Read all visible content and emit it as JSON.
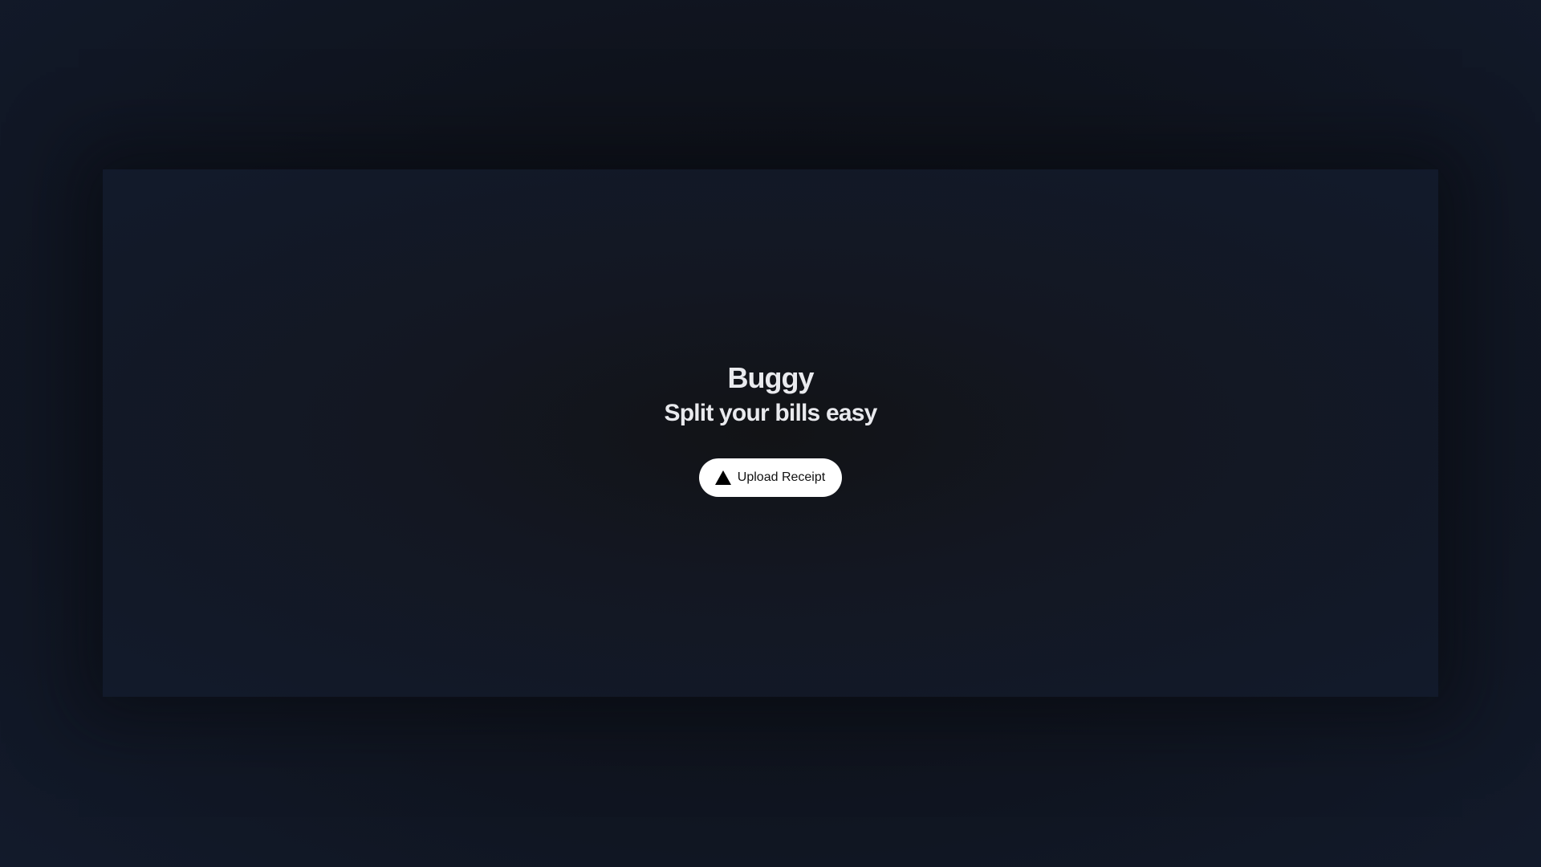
{
  "app": {
    "title": "Buggy",
    "subtitle": "Split your bills easy"
  },
  "actions": {
    "upload_label": "Upload Receipt",
    "upload_icon": "triangle-upload-icon"
  },
  "colors": {
    "background": "#0f131c",
    "text": "#e9eaee",
    "button_bg": "#ffffff",
    "button_text": "#111111"
  }
}
